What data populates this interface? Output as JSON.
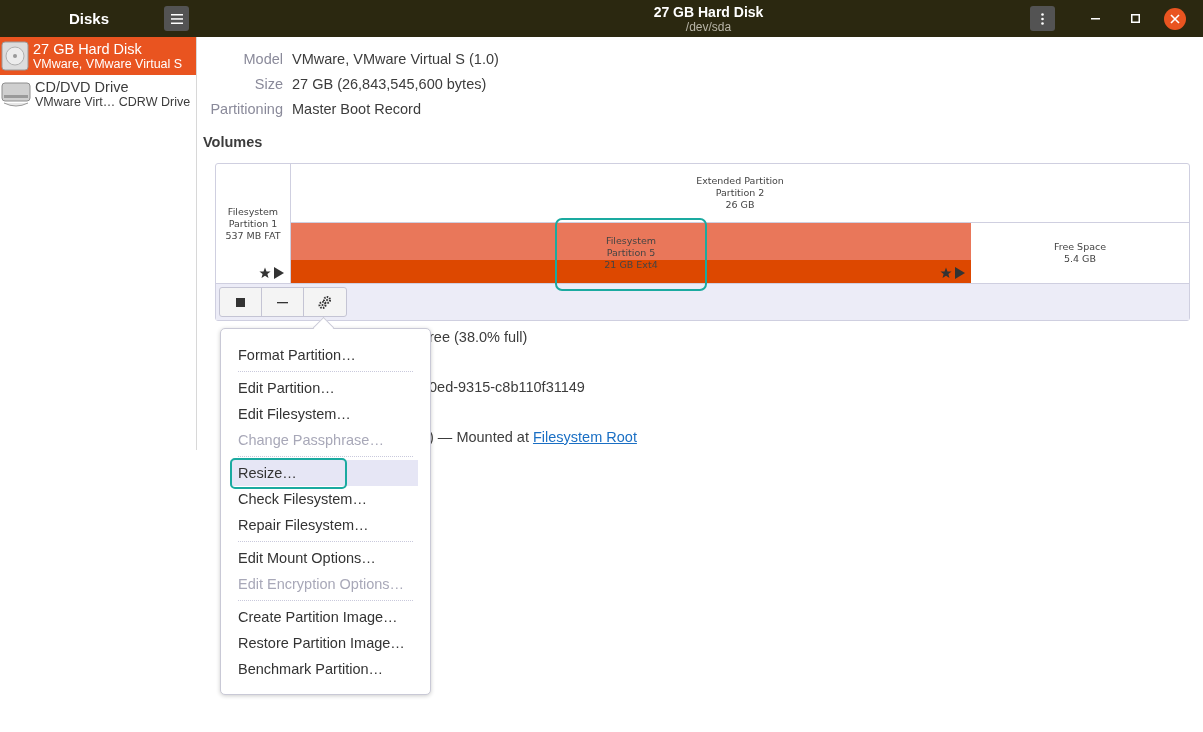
{
  "sidebar": {
    "title": "Disks",
    "items": [
      {
        "name": "27 GB Hard Disk",
        "detail": "VMware, VMware Virtual S",
        "kind": "hdd",
        "selected": true
      },
      {
        "name": "CD/DVD Drive",
        "detail": "VMware Virt… CDRW Drive",
        "kind": "optical",
        "selected": false
      }
    ]
  },
  "window": {
    "title": "27 GB Hard Disk",
    "subtitle": "/dev/sda"
  },
  "details": [
    {
      "label": "Model",
      "value": "VMware, VMware Virtual S (1.0)"
    },
    {
      "label": "Size",
      "value": "27 GB (26,843,545,600 bytes)"
    },
    {
      "label": "Partitioning",
      "value": "Master Boot Record"
    }
  ],
  "volumes": {
    "heading": "Volumes",
    "partitions": [
      {
        "kind": "primary",
        "lines": [
          "Filesystem",
          "Partition 1",
          "537 MB FAT"
        ],
        "selected": false
      },
      {
        "kind": "extended",
        "lines": [
          "Extended Partition",
          "Partition 2",
          "26 GB"
        ],
        "children": [
          {
            "kind": "logical",
            "lines": [
              "Filesystem",
              "Partition 5",
              "21 GB Ext4"
            ],
            "selected": true,
            "annotated": true
          },
          {
            "kind": "free",
            "lines": [
              "Free Space",
              "5.4 GB"
            ],
            "selected": false
          }
        ]
      }
    ],
    "tools": [
      {
        "kind": "stop"
      },
      {
        "kind": "remove"
      },
      {
        "kind": "settings"
      }
    ]
  },
  "hidden_rows": [
    {
      "text": "ree (38.0% full)"
    },
    {
      "text": "0ed-9315-c8b110f31149"
    },
    {
      "text": ") — Mounted at ",
      "link": "Filesystem Root"
    }
  ],
  "menu": {
    "groups": [
      [
        {
          "label": "Format Partition…",
          "disabled": false,
          "selected": false,
          "annotated": false
        }
      ],
      [
        {
          "label": "Edit Partition…",
          "disabled": false,
          "selected": false,
          "annotated": false
        },
        {
          "label": "Edit Filesystem…",
          "disabled": false,
          "selected": false,
          "annotated": false
        },
        {
          "label": "Change Passphrase…",
          "disabled": true,
          "selected": false,
          "annotated": false
        }
      ],
      [
        {
          "label": "Resize…",
          "disabled": false,
          "selected": true,
          "annotated": true
        },
        {
          "label": "Check Filesystem…",
          "disabled": false,
          "selected": false,
          "annotated": false
        },
        {
          "label": "Repair Filesystem…",
          "disabled": false,
          "selected": false,
          "annotated": false
        }
      ],
      [
        {
          "label": "Edit Mount Options…",
          "disabled": false,
          "selected": false,
          "annotated": false
        },
        {
          "label": "Edit Encryption Options…",
          "disabled": true,
          "selected": false,
          "annotated": false
        }
      ],
      [
        {
          "label": "Create Partition Image…",
          "disabled": false,
          "selected": false,
          "annotated": false
        },
        {
          "label": "Restore Partition Image…",
          "disabled": false,
          "selected": false,
          "annotated": false
        },
        {
          "label": "Benchmark Partition…",
          "disabled": false,
          "selected": false,
          "annotated": false
        }
      ]
    ]
  }
}
